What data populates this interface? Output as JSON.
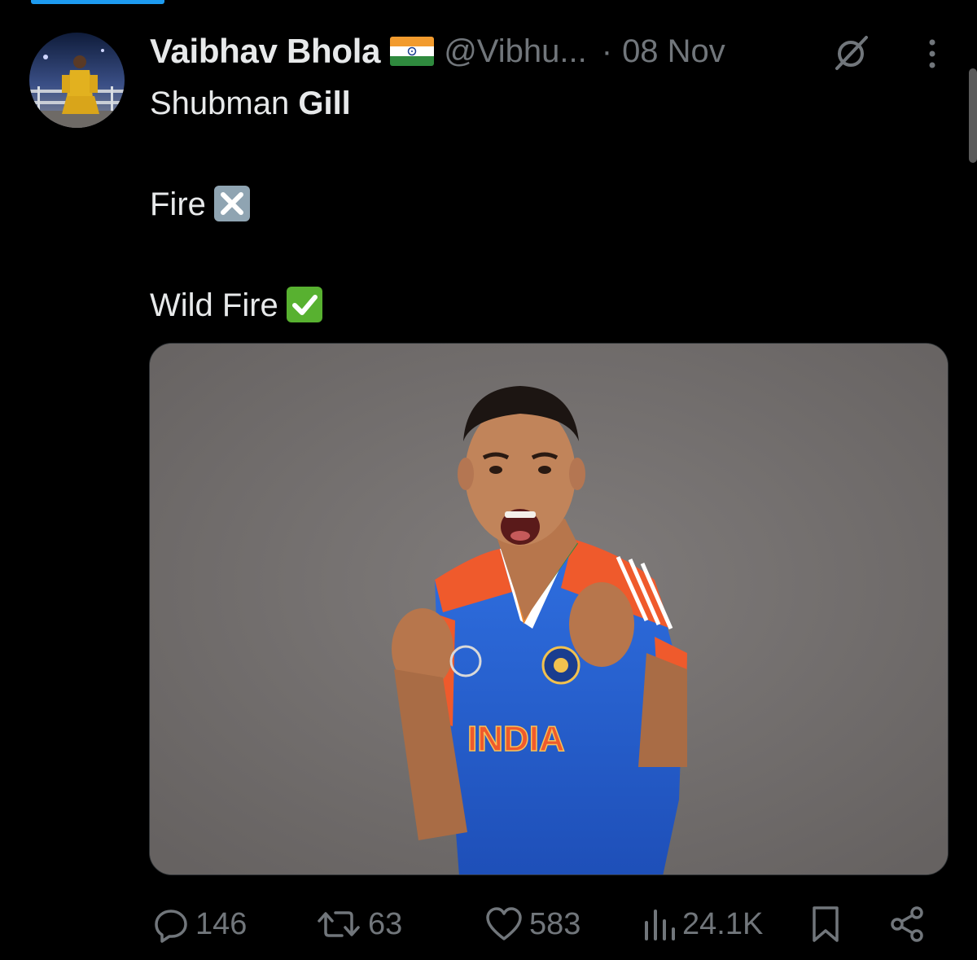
{
  "accent_color": "#1d9bf0",
  "tweet": {
    "author_name": "Vaibhav Bhola",
    "flag_icon": "india-flag-icon",
    "handle": "@Vibhu...",
    "separator": "·",
    "date": "08 Nov",
    "text": {
      "line1_regular": "Shubman ",
      "line1_bold": "Gill",
      "line2": "Fire",
      "line2_emoji": "cross-mark-icon",
      "line3": "Wild Fire",
      "line3_emoji": "check-mark-icon"
    },
    "media": {
      "jersey_text": "INDIA"
    },
    "actions": {
      "replies": "146",
      "reposts": "63",
      "likes": "583",
      "views": "24.1K"
    }
  }
}
